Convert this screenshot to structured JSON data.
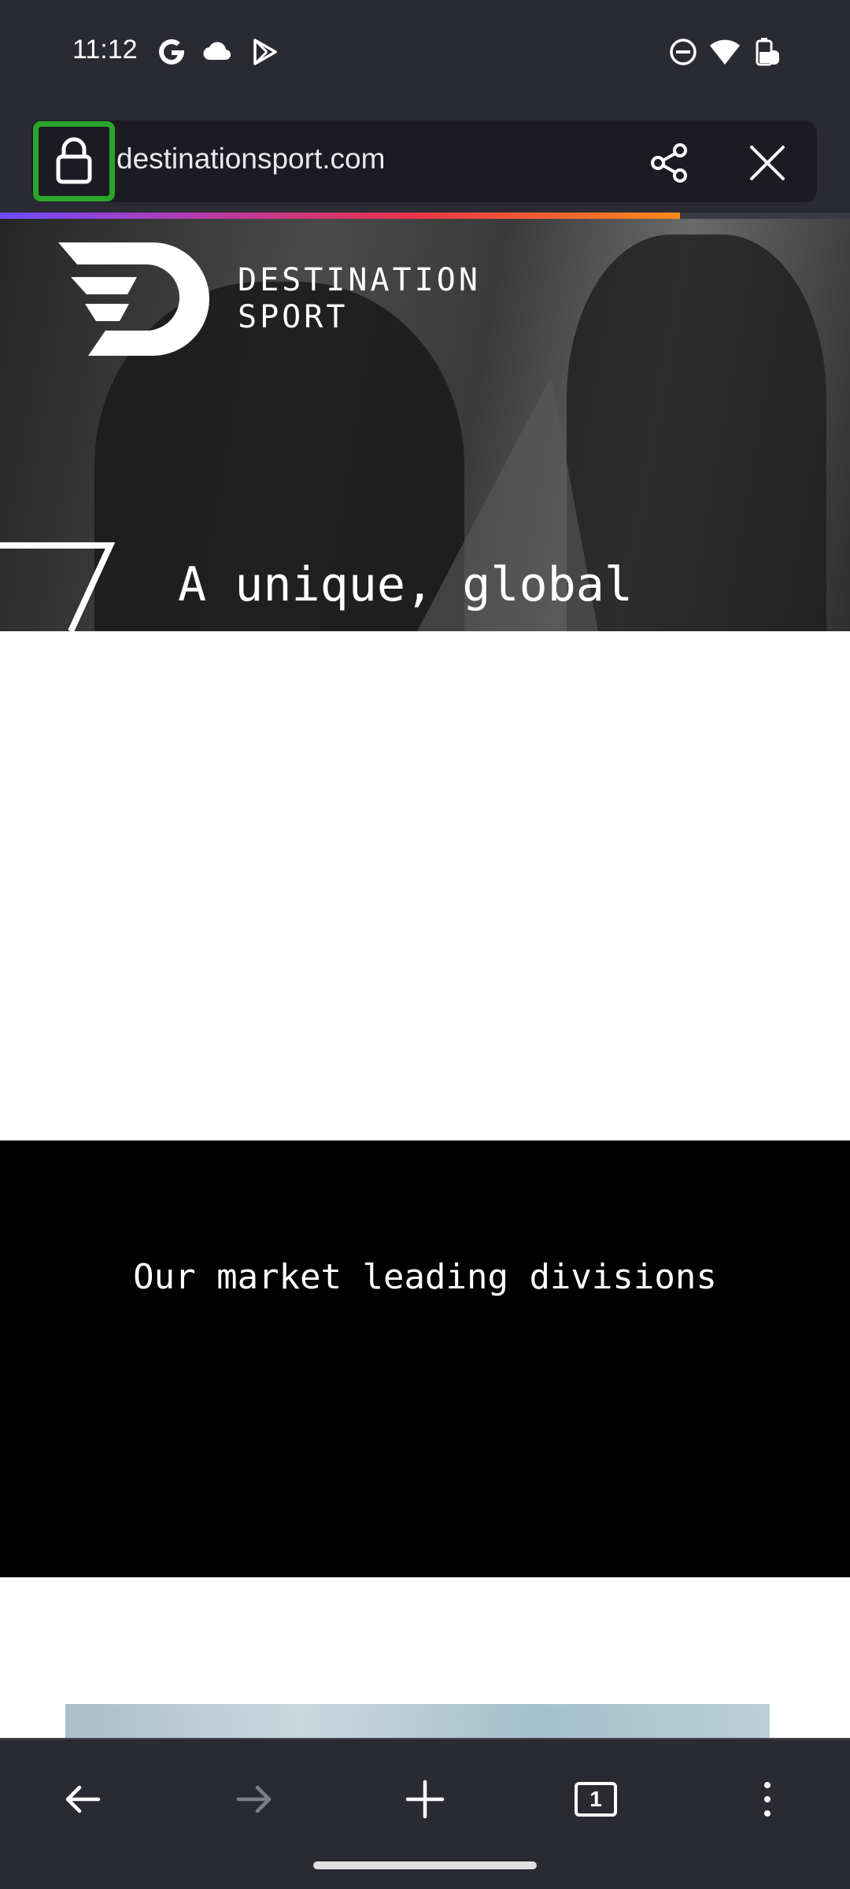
{
  "status_bar": {
    "time": "11:12",
    "left_icons": [
      "google-icon",
      "cloud-icon",
      "play-store-icon"
    ],
    "right_icons": [
      "dnd-icon",
      "wifi-icon",
      "battery-icon"
    ]
  },
  "browser": {
    "url": "destinationsport.com",
    "lock_icon": "lock-icon",
    "share_icon": "share-icon",
    "close_icon": "close-icon",
    "load_progress": 0.8,
    "highlight_color": "#2aa42a"
  },
  "page": {
    "brand": {
      "line1": "DESTINATION",
      "line2": "SPORT"
    },
    "hero_headline": "A unique, global",
    "divisions_title": "Our market leading divisions"
  },
  "bottom_nav": {
    "back": "back-arrow-icon",
    "forward": "forward-arrow-icon",
    "new_tab": "plus-icon",
    "tab_count": "1",
    "menu": "more-vert-icon"
  }
}
